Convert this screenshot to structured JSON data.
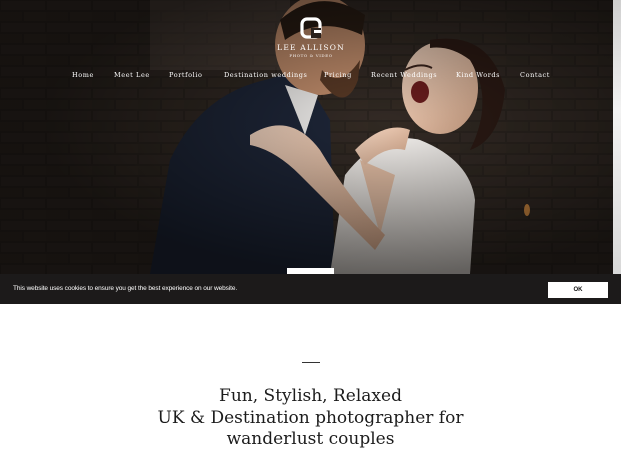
{
  "brand": {
    "name": "LEE ALLISON",
    "tagline": "PHOTO & VIDEO",
    "logo_icon": "square-a-monogram-icon"
  },
  "nav": {
    "items": [
      {
        "label": "Home"
      },
      {
        "label": "Meet Lee"
      },
      {
        "label": "Portfolio"
      },
      {
        "label": "Destination weddings"
      },
      {
        "label": "Pricing"
      },
      {
        "label": "Recent Weddings"
      },
      {
        "label": "Kind Words"
      },
      {
        "label": "Contact"
      }
    ]
  },
  "hero": {
    "image": "wedding-couple-photo"
  },
  "cookie": {
    "message": "This website uses cookies to ensure you get the best experience on our website.",
    "ok_label": "OK"
  },
  "intro": {
    "line1": "Fun, Stylish, Relaxed",
    "line2": "UK & Destination photographer for",
    "line3": "wanderlust couples"
  },
  "colors": {
    "cookie_bar": "#1c1a1a",
    "text_dark": "#1c1c1c",
    "white": "#ffffff"
  }
}
